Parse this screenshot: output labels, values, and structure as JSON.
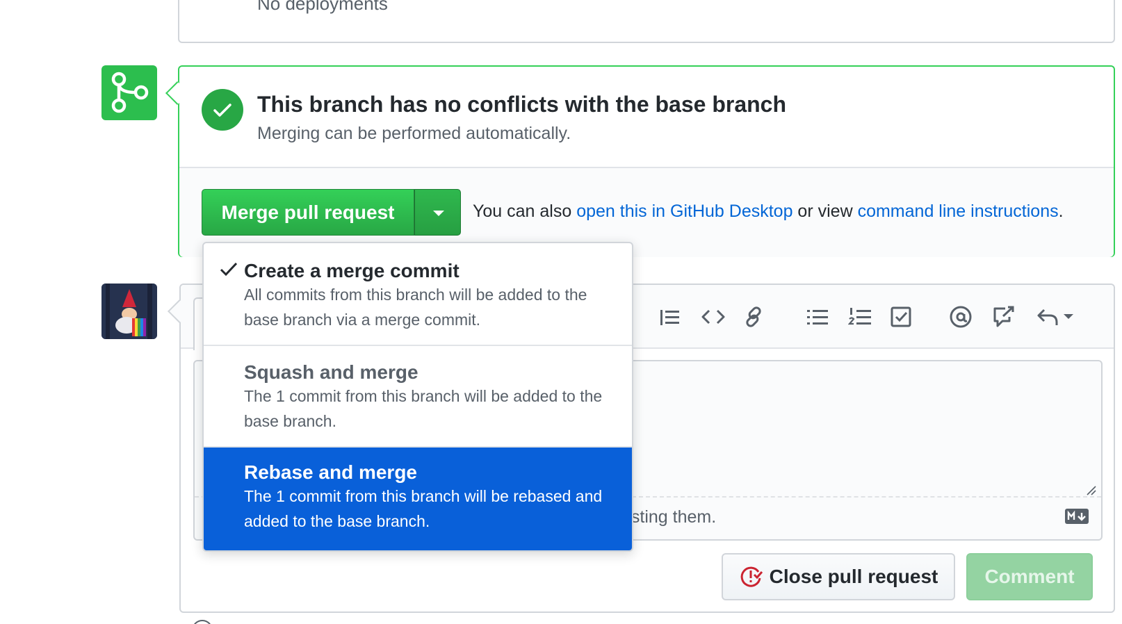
{
  "deployments": {
    "status_text": "No deployments"
  },
  "merge_panel": {
    "title": "This branch has no conflicts with the base branch",
    "subtitle": "Merging can be performed automatically.",
    "merge_button_label": "Merge pull request",
    "also_text_prefix": "You can also ",
    "desktop_link": "open this in GitHub Desktop",
    "also_text_middle": " or view ",
    "cli_link": "command line instructions",
    "also_text_suffix": "."
  },
  "merge_options": [
    {
      "title": "Create a merge commit",
      "description": "All commits from this branch will be added to the base branch via a merge commit.",
      "checked": true,
      "highlighted": false
    },
    {
      "title": "Squash and merge",
      "description": "The 1 commit from this branch will be added to the base branch.",
      "checked": false,
      "highlighted": false
    },
    {
      "title": "Rebase and merge",
      "description": "The 1 commit from this branch will be rebased and added to the base branch.",
      "checked": false,
      "highlighted": true
    }
  ],
  "comment": {
    "footer_text_visible": "asting them.",
    "close_button_label": "Close pull request",
    "comment_button_label": "Comment",
    "toolbar_icons": [
      "quote-icon",
      "code-icon",
      "link-icon",
      "unordered-list-icon",
      "ordered-list-icon",
      "task-list-icon",
      "mention-icon",
      "cross-reference-icon",
      "reply-icon"
    ]
  },
  "colors": {
    "success_green": "#28a745",
    "link_blue": "#0366d6",
    "highlight_blue": "#0960d9",
    "border_gray": "#d1d5da"
  }
}
